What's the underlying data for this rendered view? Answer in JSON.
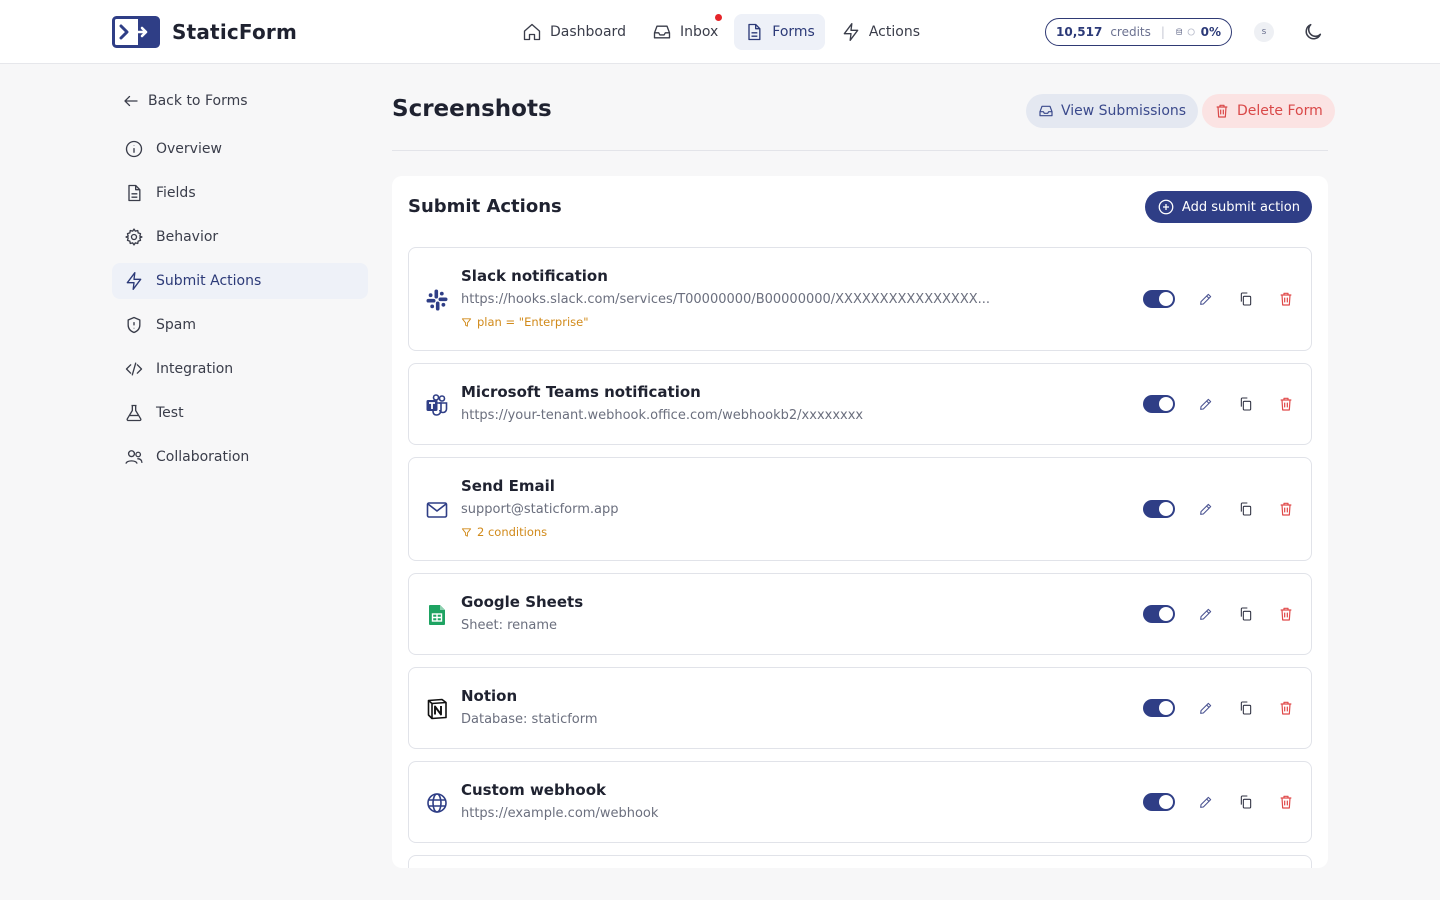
{
  "app": {
    "name": "StaticForm"
  },
  "nav": [
    {
      "label": "Dashboard",
      "icon": "home-icon"
    },
    {
      "label": "Inbox",
      "icon": "inbox-icon",
      "notification": true
    },
    {
      "label": "Forms",
      "icon": "file-icon",
      "active": true
    },
    {
      "label": "Actions",
      "icon": "bolt-icon"
    }
  ],
  "credits": {
    "count": "10,517",
    "label": "credits",
    "percent": "0%"
  },
  "user": {
    "initial": "s"
  },
  "sidebar": {
    "back_label": "Back to Forms",
    "items": [
      {
        "label": "Overview",
        "icon": "info-icon"
      },
      {
        "label": "Fields",
        "icon": "document-icon"
      },
      {
        "label": "Behavior",
        "icon": "gear-icon"
      },
      {
        "label": "Submit Actions",
        "icon": "bolt-icon",
        "active": true
      },
      {
        "label": "Spam",
        "icon": "shield-icon"
      },
      {
        "label": "Integration",
        "icon": "code-icon"
      },
      {
        "label": "Test",
        "icon": "flask-icon"
      },
      {
        "label": "Collaboration",
        "icon": "users-icon"
      }
    ]
  },
  "header": {
    "title": "Screenshots",
    "view_submissions_label": "View Submissions",
    "delete_form_label": "Delete Form"
  },
  "panel": {
    "title": "Submit Actions",
    "add_label": "Add submit action",
    "actions": [
      {
        "title": "Slack notification",
        "subtitle": "https://hooks.slack.com/services/T00000000/B00000000/XXXXXXXXXXXXXXXX...",
        "condition": "plan = \"Enterprise\"",
        "icon": "slack-icon",
        "enabled": true
      },
      {
        "title": "Microsoft Teams notification",
        "subtitle": "https://your-tenant.webhook.office.com/webhookb2/xxxxxxxx",
        "condition": null,
        "icon": "teams-icon",
        "enabled": true
      },
      {
        "title": "Send Email",
        "subtitle": "support@staticform.app",
        "condition": "2 conditions",
        "icon": "mail-icon",
        "enabled": true
      },
      {
        "title": "Google Sheets",
        "subtitle": "Sheet: rename",
        "condition": null,
        "icon": "google-sheets-icon",
        "enabled": true
      },
      {
        "title": "Notion",
        "subtitle": "Database: staticform",
        "condition": null,
        "icon": "notion-icon",
        "enabled": true
      },
      {
        "title": "Custom webhook",
        "subtitle": "https://example.com/webhook",
        "condition": null,
        "icon": "globe-icon",
        "enabled": true
      }
    ]
  },
  "colors": {
    "primary": "#2f3e86",
    "danger": "#e04a4a",
    "condition": "#d18a1a"
  }
}
